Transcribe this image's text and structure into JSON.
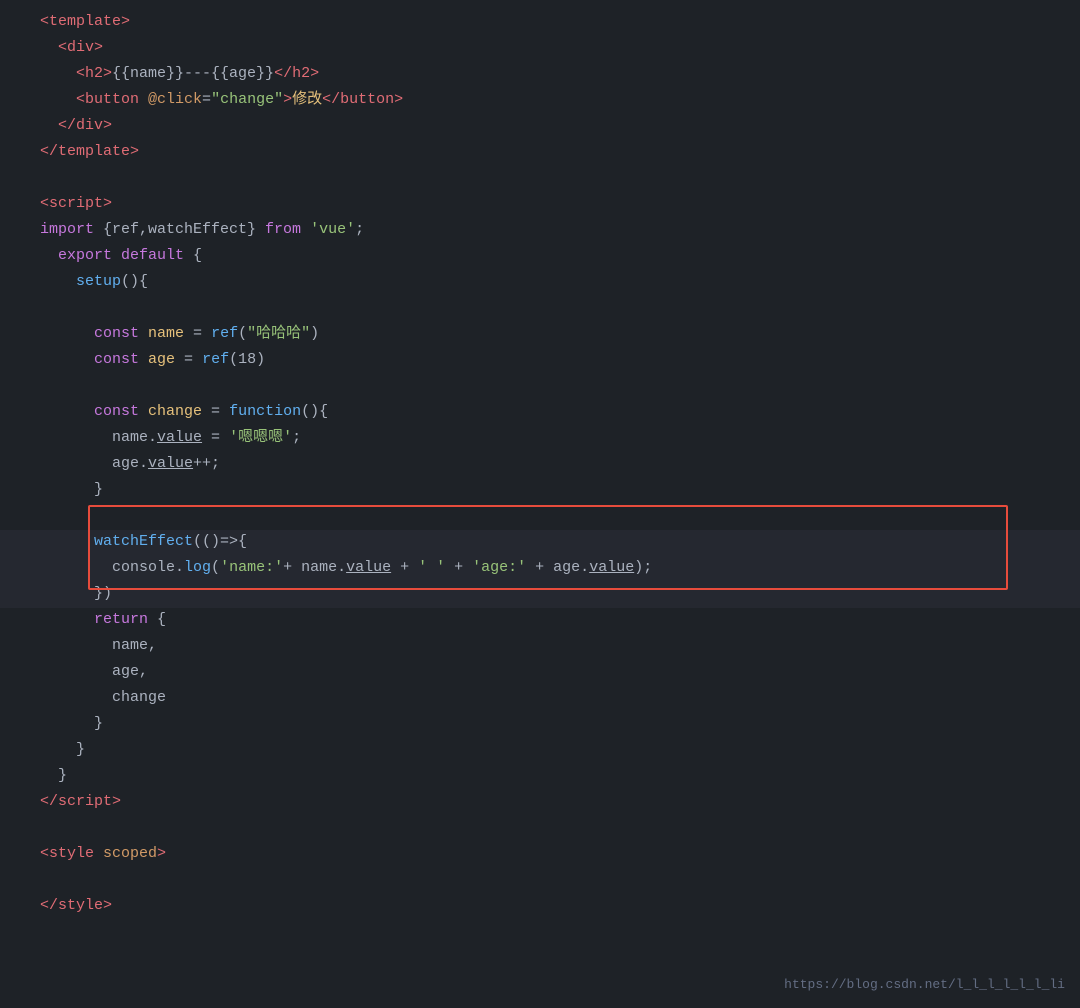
{
  "url": "https://blog.csdn.net/l_l_l_l_l_l_li",
  "lines": [
    {
      "num": "",
      "content": ""
    },
    {
      "num": "",
      "content": ""
    },
    {
      "num": "",
      "content": ""
    },
    {
      "num": "",
      "content": ""
    },
    {
      "num": "",
      "content": ""
    },
    {
      "num": "",
      "content": ""
    },
    {
      "num": "",
      "content": ""
    },
    {
      "num": "",
      "content": ""
    },
    {
      "num": "",
      "content": ""
    },
    {
      "num": "",
      "content": ""
    }
  ]
}
